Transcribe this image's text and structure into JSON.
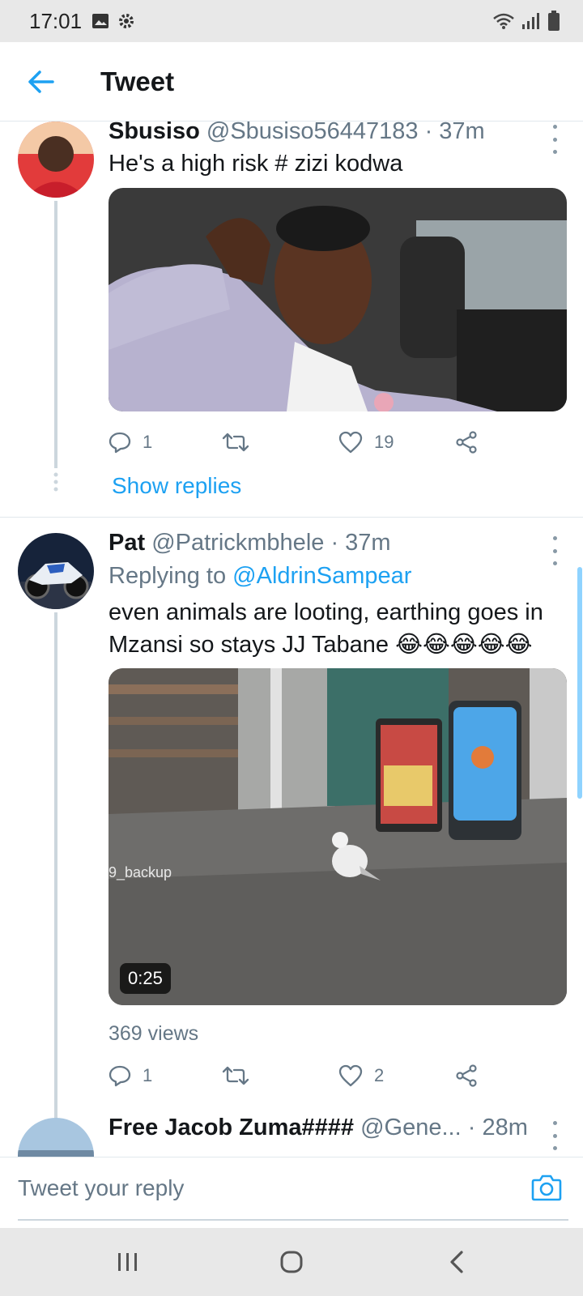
{
  "status_bar": {
    "time": "17:01",
    "icons": [
      "image-icon",
      "gear-icon",
      "wifi-icon",
      "signal-icon",
      "battery-icon"
    ]
  },
  "header": {
    "title": "Tweet",
    "back_icon": "arrow-left-icon"
  },
  "tweets": [
    {
      "name": "Sbusiso",
      "handle": "@Sbusiso56447183",
      "time": "· 37m",
      "text": "He's a high risk # zizi kodwa",
      "reply_count": "1",
      "retweet_count": "",
      "like_count": "19",
      "show_replies": "Show replies"
    },
    {
      "name": "Pat",
      "handle": "@Patrickmbhele",
      "time": "· 37m",
      "replying_label": "Replying to",
      "replying_handle": "@AldrinSampear",
      "text": "even animals are looting, earthing goes in Mzansi so stays JJ Tabane 😂😂😂😂😂",
      "video_duration": "0:25",
      "watermark": "9_backup",
      "views": "369 views",
      "reply_count": "1",
      "retweet_count": "",
      "like_count": "2"
    },
    {
      "name": "Free Jacob Zuma####",
      "handle": "@Gene...",
      "time": "· 28m"
    }
  ],
  "reply_bar": {
    "placeholder": "Tweet your reply"
  },
  "colors": {
    "accent": "#1da1f2",
    "secondary_text": "#657786",
    "divider": "#e1e8ed"
  }
}
